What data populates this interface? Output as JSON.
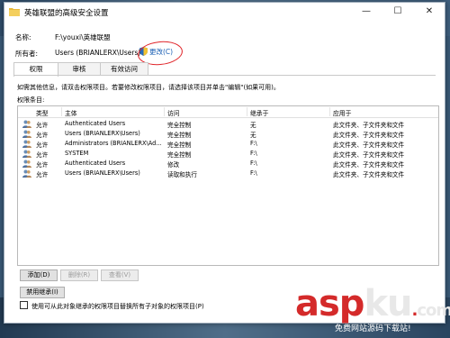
{
  "window": {
    "title": "英雄联盟的高级安全设置",
    "minimize": "—",
    "maximize": "☐",
    "close": "✕"
  },
  "info": {
    "name_label": "名称:",
    "name_value": "F:\\youxi\\英雄联盟",
    "owner_label": "所有者:",
    "owner_value": "Users (BRIANLERX\\Users)",
    "change_link": "更改(C)"
  },
  "tabs": [
    {
      "label": "权限",
      "active": true
    },
    {
      "label": "审核",
      "active": false
    },
    {
      "label": "有效访问",
      "active": false
    }
  ],
  "hint": "如需其他信息，请双击权限项目。若要修改权限项目，请选择该项目并单击\"编辑\"(如果可用)。",
  "entries_label": "权限条目:",
  "table": {
    "headers": [
      "类型",
      "主体",
      "访问",
      "继承于",
      "应用于"
    ],
    "rows": [
      {
        "type": "允许",
        "principal": "Authenticated Users",
        "access": "完全控制",
        "inherit": "无",
        "apply": "此文件夹、子文件夹和文件"
      },
      {
        "type": "允许",
        "principal": "Users (BRIANLERX\\Users)",
        "access": "完全控制",
        "inherit": "无",
        "apply": "此文件夹、子文件夹和文件"
      },
      {
        "type": "允许",
        "principal": "Administrators (BRIANLERX\\Ad...",
        "access": "完全控制",
        "inherit": "F:\\",
        "apply": "此文件夹、子文件夹和文件"
      },
      {
        "type": "允许",
        "principal": "SYSTEM",
        "access": "完全控制",
        "inherit": "F:\\",
        "apply": "此文件夹、子文件夹和文件"
      },
      {
        "type": "允许",
        "principal": "Authenticated Users",
        "access": "修改",
        "inherit": "F:\\",
        "apply": "此文件夹、子文件夹和文件"
      },
      {
        "type": "允许",
        "principal": "Users (BRIANLERX\\Users)",
        "access": "读取和执行",
        "inherit": "F:\\",
        "apply": "此文件夹、子文件夹和文件"
      }
    ]
  },
  "buttons": {
    "add": "添加(D)",
    "remove": "删除(R)",
    "view": "查看(V)",
    "disable_inheritance": "禁用继承(I)"
  },
  "checkbox_label": "使用可从此对象继承的权限项目替换所有子对象的权限项目(P)",
  "watermark": {
    "asp": "asp",
    "ku": "ku",
    "dot": ".",
    "com": "com",
    "sub": "免费网站源码下载站!"
  },
  "colors": {
    "link": "#1a5fb4",
    "annotation_circle": "#e0252a",
    "watermark_red": "#d42a2a"
  }
}
